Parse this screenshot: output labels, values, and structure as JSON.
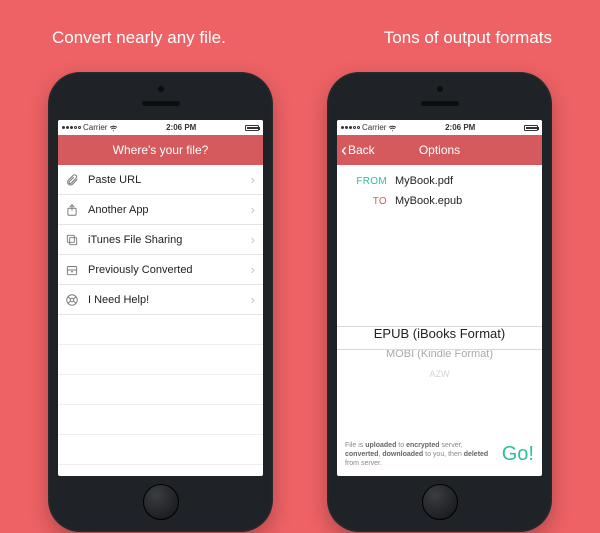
{
  "captions": {
    "left": "Convert nearly any file.",
    "right": "Tons of output formats"
  },
  "status": {
    "carrier": "Carrier",
    "time": "2:06 PM"
  },
  "left_screen": {
    "title": "Where's your file?",
    "items": [
      {
        "label": "Paste URL",
        "icon": "paperclip-icon"
      },
      {
        "label": "Another App",
        "icon": "share-icon"
      },
      {
        "label": "iTunes File Sharing",
        "icon": "copy-icon"
      },
      {
        "label": "Previously Converted",
        "icon": "archive-icon"
      },
      {
        "label": "I Need Help!",
        "icon": "help-icon"
      }
    ]
  },
  "right_screen": {
    "back": "Back",
    "title": "Options",
    "from_label": "FROM",
    "from_value": "MyBook.pdf",
    "to_label": "TO",
    "to_value": "MyBook.epub",
    "picker": [
      "EPUB (iBooks Format)",
      "MOBI (Kindle Format)",
      "AZW"
    ],
    "disclaimer_parts": {
      "t1": "File is ",
      "b1": "uploaded",
      "t2": " to ",
      "b2": "encrypted",
      "t3": " server, ",
      "b3": "converted",
      "t4": ", ",
      "b4": "downloaded",
      "t5": " to you, then ",
      "b5": "deleted",
      "t6": " from server."
    },
    "go": "Go!"
  }
}
